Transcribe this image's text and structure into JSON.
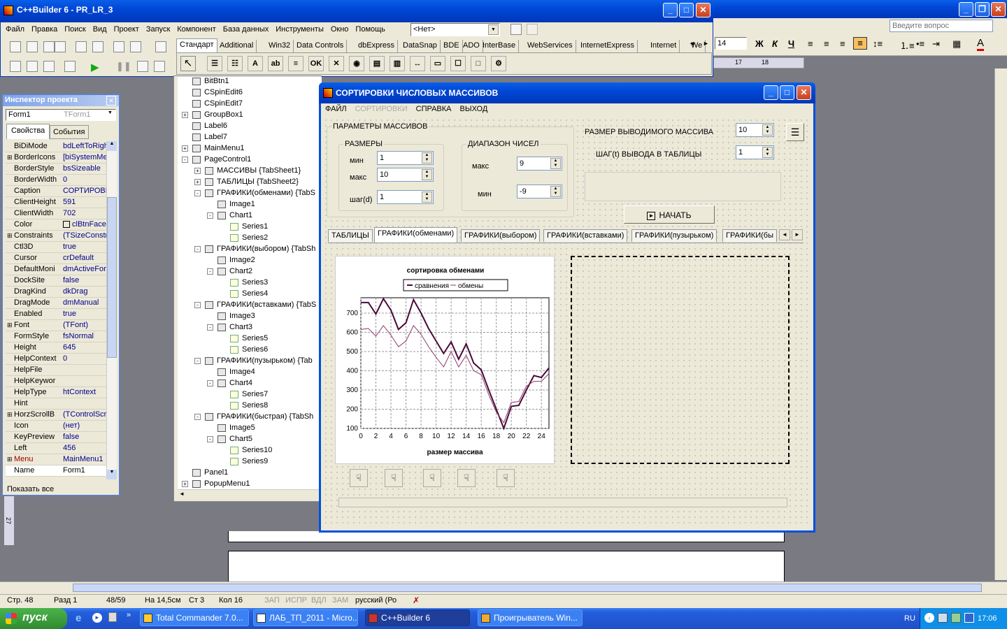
{
  "ide": {
    "title": "C++Builder 6 - PR_LR_3",
    "menu": [
      "Файл",
      "Правка",
      "Поиск",
      "Вид",
      "Проект",
      "Запуск",
      "Компонент",
      "База данных",
      "Инструменты",
      "Окно",
      "Помощь"
    ],
    "desktop_combo": "<Нет>",
    "palette_tabs": [
      "Стандарт",
      "Additional",
      "Win32",
      "Data Controls",
      "dbExpress",
      "DataSnap",
      "BDE",
      "ADO",
      "InterBase",
      "WebServices",
      "InternetExpress",
      "Internet",
      "We"
    ]
  },
  "word": {
    "search_placeholder": "Введите вопрос",
    "font_size": "14",
    "bold": "Ж",
    "italic": "К",
    "underline": "Ч",
    "ruler_a": "17",
    "ruler_b": "18",
    "vruler": "27"
  },
  "inspector": {
    "title": "Инспектор проекта",
    "object": "Form1",
    "object_type": "TForm1",
    "tab_props": "Свойства",
    "tab_events": "События",
    "show_all": "Показать все",
    "rows": [
      {
        "k": "BiDiMode",
        "v": "bdLeftToRight"
      },
      {
        "k": "BorderIcons",
        "v": "[biSystemMenu"
      },
      {
        "k": "BorderStyle",
        "v": "bsSizeable"
      },
      {
        "k": "BorderWidth",
        "v": "0"
      },
      {
        "k": "Caption",
        "v": "СОРТИРОВКИ"
      },
      {
        "k": "ClientHeight",
        "v": "591"
      },
      {
        "k": "ClientWidth",
        "v": "702"
      },
      {
        "k": "Color",
        "v": "clBtnFace"
      },
      {
        "k": "Constraints",
        "v": "(TSizeConstrai"
      },
      {
        "k": "Ctl3D",
        "v": "true"
      },
      {
        "k": "Cursor",
        "v": "crDefault"
      },
      {
        "k": "DefaultMoni",
        "v": "dmActiveForm"
      },
      {
        "k": "DockSite",
        "v": "false"
      },
      {
        "k": "DragKind",
        "v": "dkDrag"
      },
      {
        "k": "DragMode",
        "v": "dmManual"
      },
      {
        "k": "Enabled",
        "v": "true"
      },
      {
        "k": "Font",
        "v": "(TFont)"
      },
      {
        "k": "FormStyle",
        "v": "fsNormal"
      },
      {
        "k": "Height",
        "v": "645"
      },
      {
        "k": "HelpContext",
        "v": "0"
      },
      {
        "k": "HelpFile",
        "v": ""
      },
      {
        "k": "HelpKeywor",
        "v": ""
      },
      {
        "k": "HelpType",
        "v": "htContext"
      },
      {
        "k": "Hint",
        "v": ""
      },
      {
        "k": "HorzScrollB",
        "v": "(TControlScroll"
      },
      {
        "k": "Icon",
        "v": "(нет)"
      },
      {
        "k": "KeyPreview",
        "v": "false"
      },
      {
        "k": "Left",
        "v": "456"
      },
      {
        "k": "Menu",
        "v": "MainMenu1"
      },
      {
        "k": "Name",
        "v": "Form1"
      }
    ]
  },
  "tree": {
    "nodes": [
      {
        "t": "BitBtn1",
        "l": 0
      },
      {
        "t": "CSpinEdit6",
        "l": 0
      },
      {
        "t": "CSpinEdit7",
        "l": 0
      },
      {
        "t": "GroupBox1",
        "l": 0,
        "e": "+"
      },
      {
        "t": "Label6",
        "l": 0
      },
      {
        "t": "Label7",
        "l": 0
      },
      {
        "t": "MainMenu1",
        "l": 0,
        "e": "+"
      },
      {
        "t": "PageControl1",
        "l": 0,
        "e": "-"
      },
      {
        "t": "МАССИВЫ {TabSheet1}",
        "l": 1,
        "e": "+"
      },
      {
        "t": "ТАБЛИЦЫ {TabSheet2}",
        "l": 1,
        "e": "+"
      },
      {
        "t": "ГРАФИКИ(обменами) {TabS",
        "l": 1,
        "e": "-"
      },
      {
        "t": "Image1",
        "l": 2
      },
      {
        "t": "Chart1",
        "l": 2,
        "e": "-"
      },
      {
        "t": "Series1",
        "l": 3,
        "s": 1
      },
      {
        "t": "Series2",
        "l": 3,
        "s": 1
      },
      {
        "t": "ГРАФИКИ(выбором) {TabSh",
        "l": 1,
        "e": "-"
      },
      {
        "t": "Image2",
        "l": 2
      },
      {
        "t": "Chart2",
        "l": 2,
        "e": "-"
      },
      {
        "t": "Series3",
        "l": 3,
        "s": 1
      },
      {
        "t": "Series4",
        "l": 3,
        "s": 1
      },
      {
        "t": "ГРАФИКИ(вставками) {TabS",
        "l": 1,
        "e": "-"
      },
      {
        "t": "Image3",
        "l": 2
      },
      {
        "t": "Chart3",
        "l": 2,
        "e": "-"
      },
      {
        "t": "Series5",
        "l": 3,
        "s": 1
      },
      {
        "t": "Series6",
        "l": 3,
        "s": 1
      },
      {
        "t": "ГРАФИКИ(пузырьком) {Tab",
        "l": 1,
        "e": "-"
      },
      {
        "t": "Image4",
        "l": 2
      },
      {
        "t": "Chart4",
        "l": 2,
        "e": "-"
      },
      {
        "t": "Series7",
        "l": 3,
        "s": 1
      },
      {
        "t": "Series8",
        "l": 3,
        "s": 1
      },
      {
        "t": "ГРАФИКИ(быстрая) {TabSh",
        "l": 1,
        "e": "-"
      },
      {
        "t": "Image5",
        "l": 2
      },
      {
        "t": "Chart5",
        "l": 2,
        "e": "-"
      },
      {
        "t": "Series10",
        "l": 3,
        "s": 1
      },
      {
        "t": "Series9",
        "l": 3,
        "s": 1
      },
      {
        "t": "Panel1",
        "l": 0
      },
      {
        "t": "PopupMenu1",
        "l": 0,
        "e": "+"
      }
    ]
  },
  "form": {
    "title": "СОРТИРОВКИ ЧИСЛОВЫХ МАССИВОВ",
    "menu": [
      "ФАЙЛ",
      "СОРТИРОВКИ",
      "СПРАВКА",
      "ВЫХОД"
    ],
    "params_group": "ПАРАМЕТРЫ МАССИВОВ",
    "sizes_group": "РАЗМЕРЫ",
    "range_group": "ДИАПАЗОН ЧИСЕЛ",
    "min_label": "мин",
    "max_label": "макс",
    "step_label": "шаг(d)",
    "min_val": "1",
    "max_val": "10",
    "step_val": "1",
    "range_max_label": "макс",
    "range_min_label": "мин",
    "range_max_val": "9",
    "range_min_val": "-9",
    "out_size_label": "РАЗМЕР ВЫВОДИМОГО МАССИВА",
    "out_size_val": "10",
    "out_step_label": "ШАГ(t) ВЫВОДА В ТАБЛИЦЫ",
    "out_step_val": "1",
    "start_button": "НАЧАТЬ",
    "tabs": [
      "ТАБЛИЦЫ",
      "ГРАФИКИ(обменами)",
      "ГРАФИКИ(выбором)",
      "ГРАФИКИ(вставками)",
      "ГРАФИКИ(пузырьком)",
      "ГРАФИКИ(бы"
    ]
  },
  "chart_data": {
    "type": "line",
    "title": "сортировка обменами",
    "xlabel": "размер массива",
    "ylabel": "",
    "legend": [
      "сравнения",
      "обмены"
    ],
    "legend_position": "top",
    "grid": true,
    "xlim": [
      0,
      25
    ],
    "ylim": [
      100,
      780
    ],
    "xticks": [
      0,
      2,
      4,
      6,
      8,
      10,
      12,
      14,
      16,
      18,
      20,
      22,
      24
    ],
    "yticks": [
      100,
      200,
      300,
      400,
      500,
      600,
      700
    ],
    "x": [
      0,
      1,
      2,
      3,
      4,
      5,
      6,
      7,
      8,
      9,
      10,
      11,
      12,
      13,
      14,
      15,
      16,
      17,
      18,
      19,
      20,
      21,
      22,
      23,
      24,
      25
    ],
    "series": [
      {
        "name": "сравнения",
        "color": "#4a0a3a",
        "values": [
          755,
          755,
          695,
          775,
          715,
          615,
          650,
          770,
          700,
          620,
          555,
          490,
          550,
          460,
          540,
          440,
          405,
          300,
          200,
          100,
          215,
          220,
          300,
          375,
          365,
          415
        ]
      },
      {
        "name": "обмены",
        "color": "#8a3a6e",
        "values": [
          615,
          620,
          580,
          635,
          585,
          525,
          555,
          635,
          590,
          525,
          470,
          420,
          500,
          420,
          480,
          400,
          380,
          275,
          185,
          130,
          235,
          240,
          320,
          345,
          345,
          385
        ]
      }
    ]
  },
  "status": {
    "page": "Стр. 48",
    "section": "Разд 1",
    "pages": "48/59",
    "at": "На 14,5см",
    "line": "Ст 3",
    "col": "Кол 16",
    "rec": "ЗАП",
    "trk": "ИСПР",
    "ext": "ВДЛ",
    "ovr": "ЗАМ",
    "lang": "русский (Ро"
  },
  "taskbar": {
    "start": "пуск",
    "items": [
      "Total Commander 7.0...",
      "ЛАБ_ТП_2011 - Micro...",
      "C++Builder 6",
      "Проигрыватель Win..."
    ],
    "lang": "RU",
    "clock": "17:06"
  }
}
